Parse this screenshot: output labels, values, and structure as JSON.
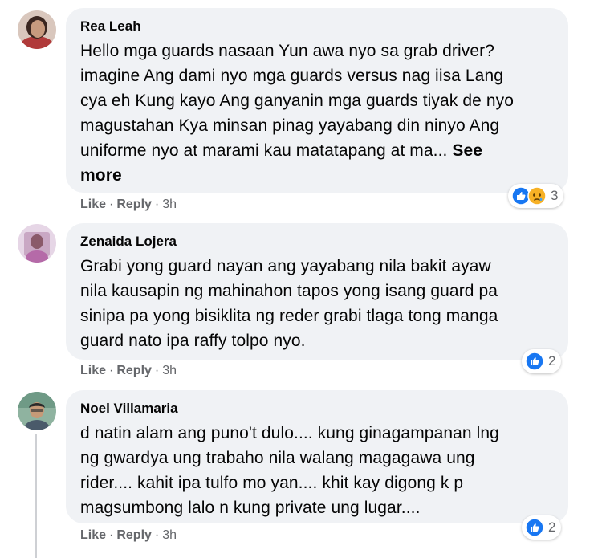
{
  "comments": [
    {
      "author": "Rea Leah",
      "text": "Hello mga guards nasaan Yun awa nyo sa grab driver?\nimagine Ang dami nyo mga guards versus nag iisa Lang\ncya eh Kung kayo Ang ganyanin mga guards tiyak de nyo\nmagustahan Kya minsan pinag yayabang din ninyo Ang\nuniforme nyo at marami kau matatapang at ma... ",
      "see_more": "See\nmore",
      "like": "Like",
      "reply": "Reply",
      "time": "3h",
      "reactions": [
        "like-icon",
        "sad-icon"
      ],
      "reaction_count": "3"
    },
    {
      "author": "Zenaida Lojera",
      "text": "Grabi yong guard nayan ang yayabang nila bakit ayaw\nnila kausapin ng mahinahon tapos yong isang guard pa\nsinipa pa yong bisiklita ng reder grabi tlaga tong manga\nguard nato ipa raffy tolpo nyo.",
      "like": "Like",
      "reply": "Reply",
      "time": "3h",
      "reactions": [
        "like-icon"
      ],
      "reaction_count": "2"
    },
    {
      "author": "Noel Villamaria",
      "text": "d natin alam ang puno't dulo.... kung ginagampanan lng\nng gwardya ung trabaho nila walang magagawa ung\nrider.... kahit ipa tulfo mo yan.... khit kay digong k p\nmagsumbong lalo n kung private ung lugar....",
      "like": "Like",
      "reply": "Reply",
      "time": "3h",
      "reactions": [
        "like-icon"
      ],
      "reaction_count": "2"
    }
  ],
  "separator": "·",
  "colors": {
    "bubble": "#f0f2f5",
    "meta": "#65676b",
    "like_blue": "#1877f2",
    "sad_yellow": "#f7b125"
  }
}
